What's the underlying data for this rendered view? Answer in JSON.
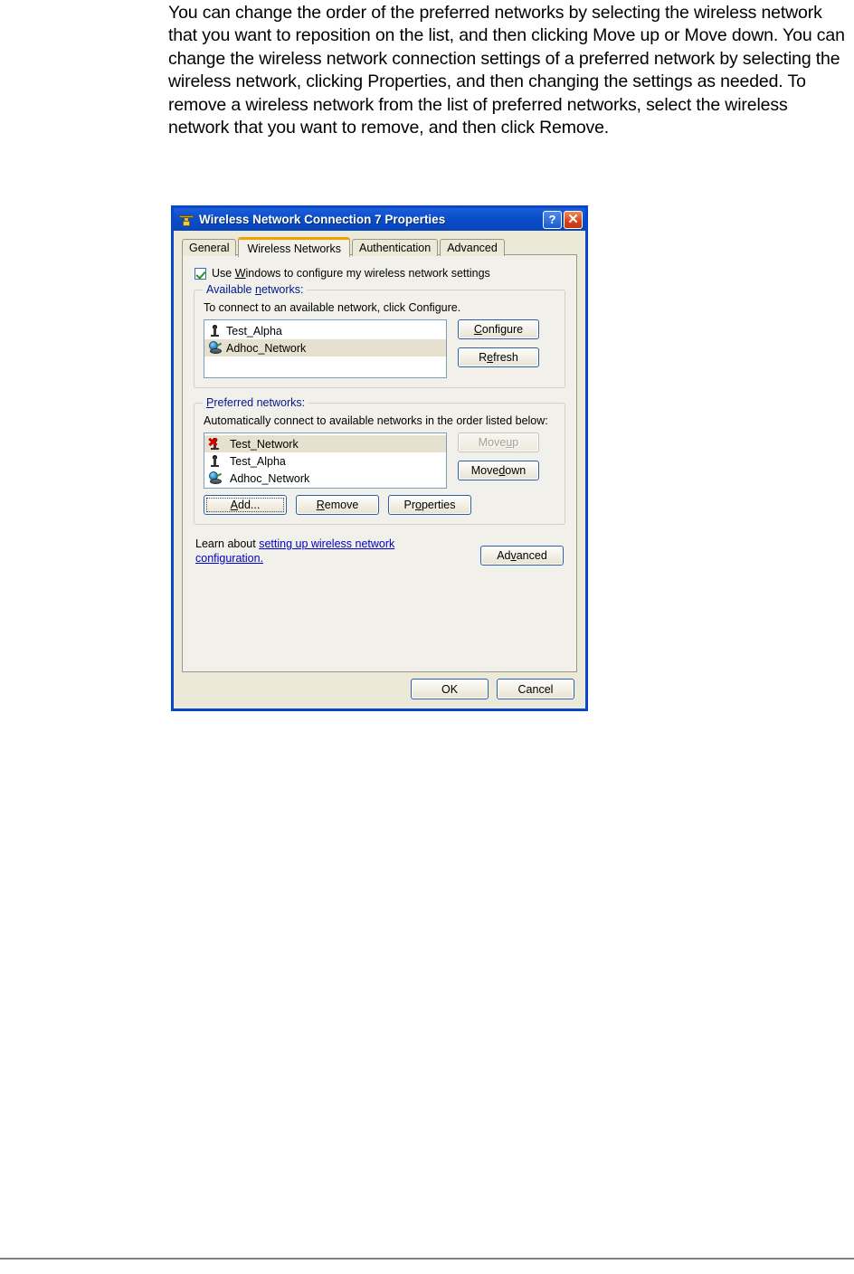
{
  "document": {
    "paragraph": "You can change the order of the preferred networks by selecting the wireless network that you want to reposition on the list, and then clicking Move up or Move down. You can change the wireless network connection settings of a preferred network by selecting the wireless network, clicking Properties, and then changing the settings as needed. To remove a wireless network from the list of preferred networks, select the wireless network that you want to remove, and then click Remove."
  },
  "dialog": {
    "title": "Wireless Network Connection 7 Properties",
    "title_icon": "network-connection-icon",
    "titlebar_color": "#0A4EC9",
    "help_button": "?",
    "close_button": "✕",
    "tabs": [
      {
        "label": "General",
        "active": false
      },
      {
        "label": "Wireless Networks",
        "active": true
      },
      {
        "label": "Authentication",
        "active": false
      },
      {
        "label": "Advanced",
        "active": false
      }
    ],
    "use_windows_checkbox": {
      "label_prefix": "Use ",
      "label_accelerator": "W",
      "label_suffix": "indows to configure my wireless network settings",
      "checked": true
    },
    "available_networks": {
      "label_prefix": "Available ",
      "label_accelerator": "n",
      "label_suffix": "etworks:",
      "hint": "To connect to an available network, click Configure.",
      "items": [
        {
          "name": "Test_Alpha",
          "icon": "wireless-tower-icon",
          "selected": false
        },
        {
          "name": "Adhoc_Network",
          "icon": "adhoc-network-icon",
          "selected": true
        }
      ],
      "buttons": [
        {
          "label_prefix": "",
          "accelerator": "C",
          "label_suffix": "onfigure",
          "disabled": false
        },
        {
          "label_prefix": "R",
          "accelerator": "e",
          "label_suffix": "fresh",
          "disabled": false
        }
      ]
    },
    "preferred_networks": {
      "label_accelerator": "P",
      "label_suffix": "referred networks:",
      "hint": "Automatically connect to available networks in the order listed below:",
      "items": [
        {
          "name": "Test_Network",
          "icon": "wireless-tower-unavailable-icon",
          "selected": true
        },
        {
          "name": "Test_Alpha",
          "icon": "wireless-tower-icon",
          "selected": false
        },
        {
          "name": "Adhoc_Network",
          "icon": "adhoc-network-icon",
          "selected": false
        }
      ],
      "move_up": {
        "label_prefix": "Move ",
        "accelerator": "u",
        "label_suffix": "p",
        "disabled": true
      },
      "move_down": {
        "label_prefix": "Move ",
        "accelerator": "d",
        "label_suffix": "own",
        "disabled": false
      },
      "action_buttons": [
        {
          "label_prefix": "",
          "accelerator": "A",
          "label_suffix": "dd...",
          "focused": true
        },
        {
          "label_prefix": "",
          "accelerator": "R",
          "label_suffix": "emove",
          "focused": false
        },
        {
          "label_prefix": "Pr",
          "accelerator": "o",
          "label_suffix": "perties",
          "focused": false
        }
      ]
    },
    "learn_about": {
      "prefix": "Learn about ",
      "link": "setting up wireless network configuration.",
      "advanced_button": {
        "label_prefix": "Ad",
        "accelerator": "v",
        "label_suffix": "anced"
      }
    },
    "footer": {
      "ok_label": "OK",
      "cancel_label": "Cancel"
    }
  }
}
